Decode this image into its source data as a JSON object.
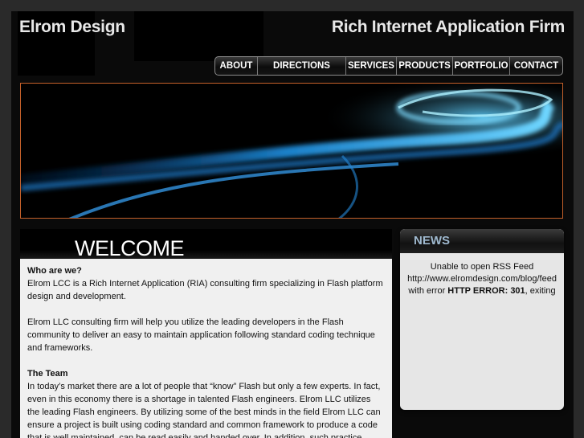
{
  "header": {
    "brand": "Elrom Design",
    "tagline": "Rich Internet Application Firm"
  },
  "nav": {
    "items": [
      {
        "label": "ABOUT"
      },
      {
        "label": "DIRECTIONS"
      },
      {
        "label": "SERVICES"
      },
      {
        "label": "PRODUCTS"
      },
      {
        "label": "PORTFOLIO"
      },
      {
        "label": "CONTACT"
      }
    ]
  },
  "welcome": {
    "title": "WELCOME",
    "who_heading": "Who are we?",
    "who_text": "Elrom LCC is a Rich Internet Application (RIA) consulting firm specializing in Flash platform design and development.",
    "help_text": "Elrom LLC consulting firm will help you utilize the leading developers in the Flash community to deliver an easy to maintain application following standard coding technique and frameworks.",
    "team_heading": "The Team",
    "team_text": "In today’s market there are a lot of people that “know” Flash but only a few experts. In fact, even in this economy there is a shortage in talented Flash engineers. Elrom LLC utilizes the leading Flash engineers. By utilizing some of the best minds in the field Elrom LLC can ensure a project is built using coding standard and common framework to produce a code that is well maintained, can be read easily and handed over. In addition, such practice"
  },
  "news": {
    "title": "NEWS",
    "line1": "Unable to open RSS Feed",
    "line2": "http://www.elromdesign.com/blog/feed",
    "line3_prefix": "with error",
    "error_code": "HTTP ERROR: 301",
    "line3_suffix": ", exiting"
  },
  "colors": {
    "banner_border": "#c4602a",
    "news_title": "#9fb9cf",
    "banner_glow": "#2ab4ff"
  }
}
